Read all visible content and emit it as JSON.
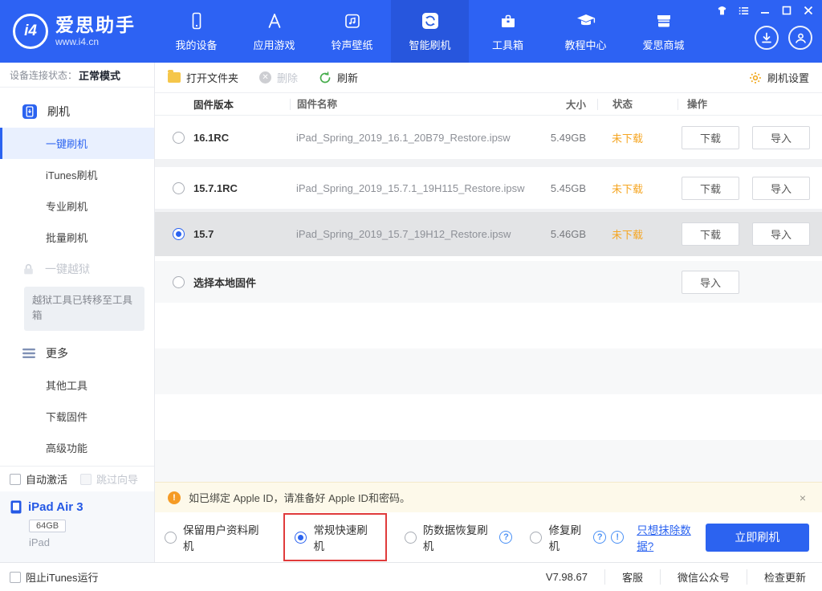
{
  "colors": {
    "accent": "#2b63f0",
    "header_bg": "#2d62f3",
    "status_warn": "#f5a623",
    "highlight_red": "#e03b3b"
  },
  "header": {
    "logo": {
      "badge": "i4",
      "title": "爱思助手",
      "subtitle": "www.i4.cn"
    },
    "nav": [
      {
        "label": "我的设备",
        "active": false
      },
      {
        "label": "应用游戏",
        "active": false
      },
      {
        "label": "铃声壁纸",
        "active": false
      },
      {
        "label": "智能刷机",
        "active": true
      },
      {
        "label": "工具箱",
        "active": false
      },
      {
        "label": "教程中心",
        "active": false
      },
      {
        "label": "爱思商城",
        "active": false
      }
    ]
  },
  "sidebar": {
    "status_label": "设备连接状态：",
    "status_value": "正常模式",
    "group_flash": "刷机",
    "items": [
      {
        "label": "一键刷机",
        "active": true
      },
      {
        "label": "iTunes刷机",
        "active": false
      },
      {
        "label": "专业刷机",
        "active": false
      },
      {
        "label": "批量刷机",
        "active": false
      }
    ],
    "group_jailbreak": "一键越狱",
    "jailbreak_note": "越狱工具已转移至工具箱",
    "group_more": "更多",
    "more_items": [
      {
        "label": "其他工具"
      },
      {
        "label": "下载固件"
      },
      {
        "label": "高级功能"
      }
    ],
    "checkbox_auto_activate": "自动激活",
    "checkbox_skip_wizard": "跳过向导",
    "device": {
      "name": "iPad Air 3",
      "capacity": "64GB",
      "type": "iPad"
    }
  },
  "toolbar": {
    "open_folder": "打开文件夹",
    "delete": "删除",
    "refresh": "刷新",
    "settings": "刷机设置"
  },
  "table": {
    "headers": {
      "version": "固件版本",
      "name": "固件名称",
      "size": "大小",
      "status": "状态",
      "action": "操作"
    },
    "download_label": "下载",
    "import_label": "导入",
    "rows": [
      {
        "version": "16.1RC",
        "filename": "iPad_Spring_2019_16.1_20B79_Restore.ipsw",
        "size": "5.49GB",
        "status": "未下载",
        "selected": false
      },
      {
        "version": "15.7.1RC",
        "filename": "iPad_Spring_2019_15.7.1_19H115_Restore.ipsw",
        "size": "5.45GB",
        "status": "未下载",
        "selected": false
      },
      {
        "version": "15.7",
        "filename": "iPad_Spring_2019_15.7_19H12_Restore.ipsw",
        "size": "5.46GB",
        "status": "未下载",
        "selected": true
      },
      {
        "version": "选择本地固件",
        "selected": false,
        "local": true
      }
    ]
  },
  "warning": {
    "text": "如已绑定 Apple ID，请准备好 Apple ID和密码。",
    "close": "×"
  },
  "flash_options": {
    "options": [
      {
        "label": "保留用户资料刷机",
        "selected": false,
        "help": false,
        "highlighted": false
      },
      {
        "label": "常规快速刷机",
        "selected": true,
        "help": false,
        "highlighted": true
      },
      {
        "label": "防数据恢复刷机",
        "selected": false,
        "help": true,
        "highlighted": false
      },
      {
        "label": "修复刷机",
        "selected": false,
        "help": true,
        "info": true,
        "highlighted": false
      }
    ],
    "erase_link": "只想抹除数据?",
    "flash_button": "立即刷机"
  },
  "statusbar": {
    "block_itunes": "阻止iTunes运行",
    "version": "V7.98.67",
    "items": [
      "客服",
      "微信公众号",
      "检查更新"
    ]
  }
}
